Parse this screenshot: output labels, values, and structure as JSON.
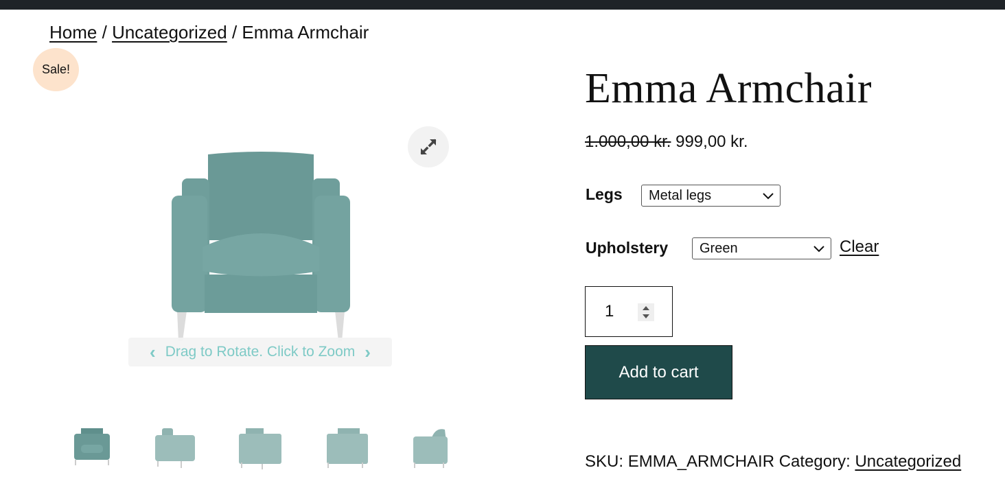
{
  "breadcrumb": {
    "items": [
      {
        "label": "Home",
        "link": true
      },
      {
        "label": "Uncategorized",
        "link": true
      },
      {
        "label": "Emma Armchair",
        "link": false
      }
    ],
    "separator": "/"
  },
  "gallery": {
    "sale_badge": "Sale!",
    "zoom_icon": "expand-icon",
    "rotate_hint": "Drag to Rotate. Click to Zoom",
    "prev_icon": "chevron-left-icon",
    "next_icon": "chevron-right-icon",
    "thumbnails": [
      {
        "view": "front"
      },
      {
        "view": "front-left"
      },
      {
        "view": "back-left"
      },
      {
        "view": "back"
      },
      {
        "view": "side"
      }
    ],
    "upholstery_color": "#6c9c99"
  },
  "product": {
    "title": "Emma Armchair",
    "old_price": "1.000,00 kr.",
    "price": "999,00 kr.",
    "attributes": [
      {
        "label": "Legs",
        "selected": "Metal legs"
      },
      {
        "label": "Upholstery",
        "selected": "Green"
      }
    ],
    "clear_label": "Clear",
    "quantity": "1",
    "add_to_cart": "Add to cart",
    "sku_label": "SKU:",
    "sku": "EMMA_ARMCHAIR",
    "category_label": "Category:",
    "category": "Uncategorized"
  },
  "colors": {
    "accent": "#1f4a4a",
    "sale_badge_bg": "#fde3cc",
    "rotate_text": "#7ecac6",
    "topbar": "#1f2328"
  }
}
